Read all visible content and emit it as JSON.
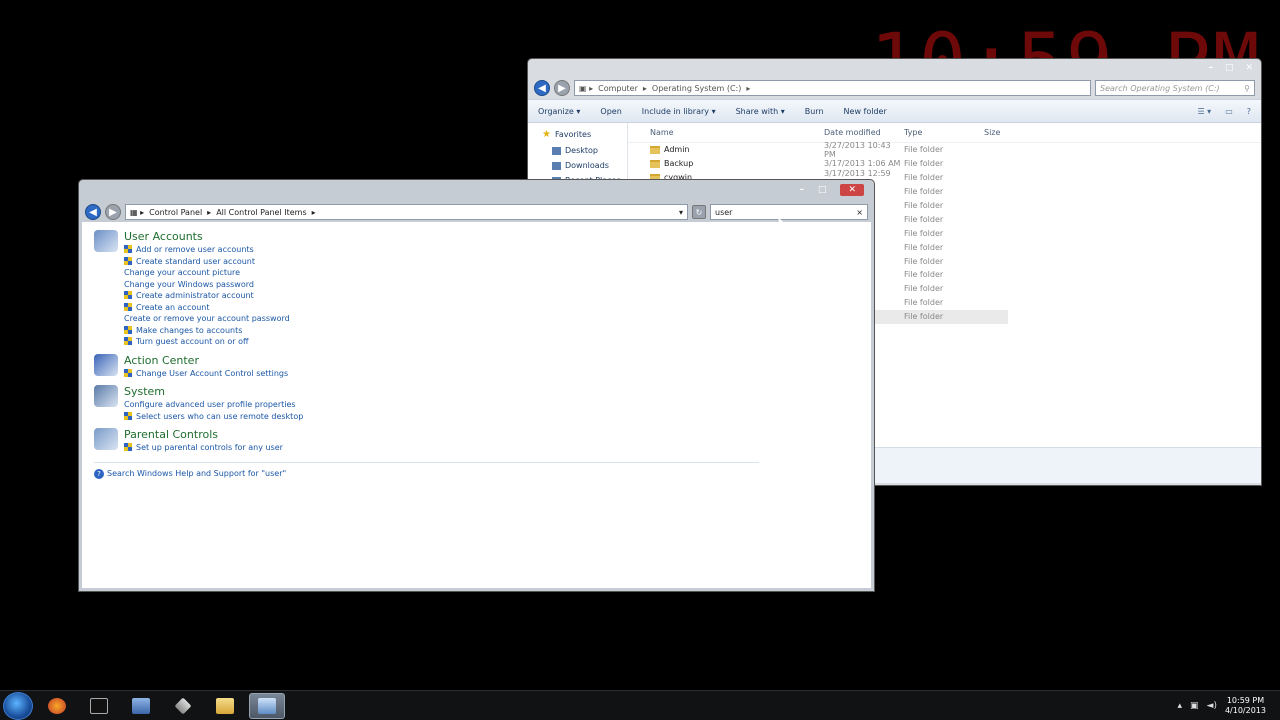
{
  "desktop": {
    "clock_gadget": "10:59 PM"
  },
  "explorer": {
    "address": {
      "parts": [
        "Computer",
        "Operating System (C:)"
      ]
    },
    "search_placeholder": "Search Operating System (C:)",
    "toolbar": {
      "organize": "Organize ▾",
      "open": "Open",
      "include": "Include in library ▾",
      "share": "Share with ▾",
      "burn": "Burn",
      "new_folder": "New folder"
    },
    "navpane": {
      "favorites": "Favorites",
      "items": [
        "Desktop",
        "Downloads",
        "Recent Places"
      ]
    },
    "columns": {
      "name": "Name",
      "date": "Date modified",
      "type": "Type",
      "size": "Size"
    },
    "rows": [
      {
        "name": "Admin",
        "date": "3/27/2013 10:43 PM",
        "type": "File folder"
      },
      {
        "name": "Backup",
        "date": "3/17/2013 1:06 AM",
        "type": "File folder"
      },
      {
        "name": "cygwin",
        "date": "3/17/2013 12:59 AM",
        "type": "File folder"
      },
      {
        "name": "",
        "date": "AM",
        "type": "File folder"
      },
      {
        "name": "",
        "date": "AM",
        "type": "File folder"
      },
      {
        "name": "",
        "date": "AM",
        "type": "File folder"
      },
      {
        "name": "",
        "date": "AM",
        "type": "File folder"
      },
      {
        "name": "",
        "date": "M",
        "type": "File folder"
      },
      {
        "name": "",
        "date": "PM",
        "type": "File folder"
      },
      {
        "name": "",
        "date": "PM",
        "type": "File folder"
      },
      {
        "name": "",
        "date": "PM",
        "type": "File folder"
      },
      {
        "name": "",
        "date": "PM",
        "type": "File folder"
      },
      {
        "name": "",
        "date": "PM",
        "type": "File folder"
      }
    ]
  },
  "control_panel": {
    "address": {
      "parts": [
        "Control Panel",
        "All Control Panel Items"
      ]
    },
    "search_value": "user",
    "categories": [
      {
        "title": "User Accounts",
        "tasks": [
          {
            "label": "Add or remove user accounts",
            "shield": true
          },
          {
            "label": "Create standard user account",
            "shield": true
          },
          {
            "label": "Change your account picture",
            "shield": false
          },
          {
            "label": "Change your Windows password",
            "shield": false
          },
          {
            "label": "Create administrator account",
            "shield": true
          },
          {
            "label": "Create an account",
            "shield": true
          },
          {
            "label": "Create or remove your account password",
            "shield": false
          },
          {
            "label": "Make changes to accounts",
            "shield": true
          },
          {
            "label": "Turn guest account on or off",
            "shield": true
          }
        ]
      },
      {
        "title": "Action Center",
        "tasks": [
          {
            "label": "Change User Account Control settings",
            "shield": true
          }
        ]
      },
      {
        "title": "System",
        "tasks": [
          {
            "label": "Configure advanced user profile properties",
            "shield": false
          },
          {
            "label": "Select users who can use remote desktop",
            "shield": true
          }
        ]
      },
      {
        "title": "Parental Controls",
        "tasks": [
          {
            "label": "Set up parental controls for any user",
            "shield": true
          }
        ]
      }
    ],
    "help_link": "Search Windows Help and Support for \"user\""
  },
  "taskbar": {
    "time": "10:59 PM",
    "date": "4/10/2013"
  }
}
